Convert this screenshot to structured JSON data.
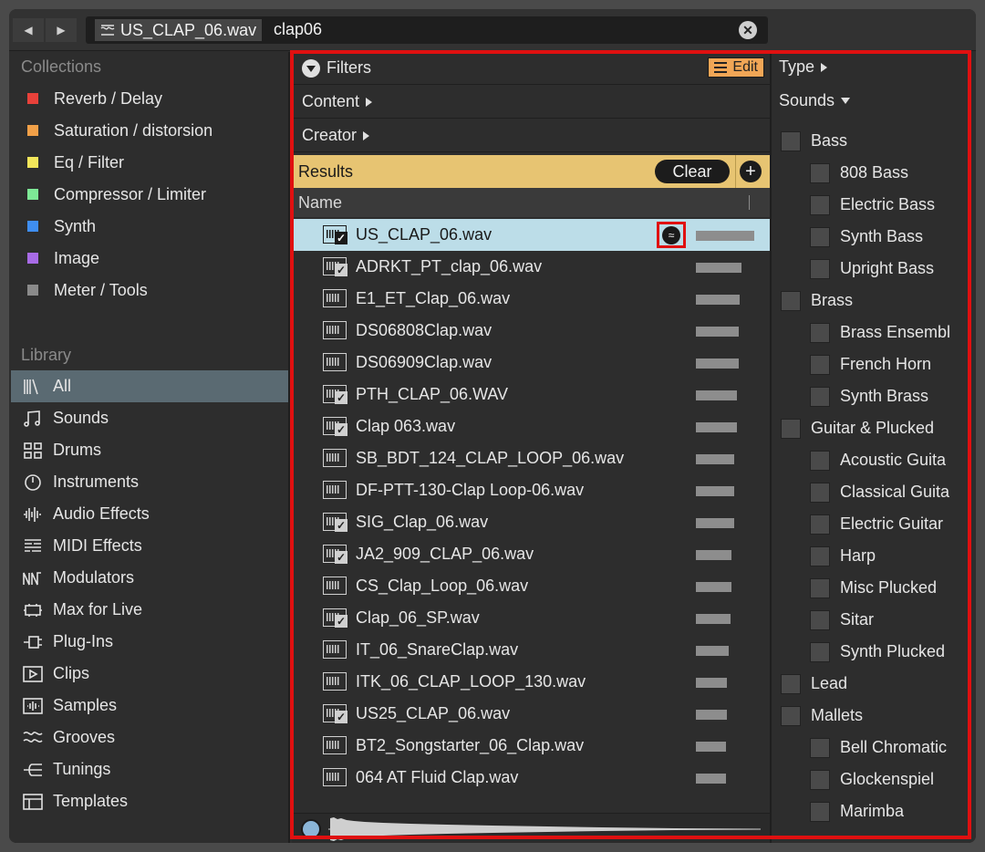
{
  "topbar": {
    "back": "◀",
    "forward": "▶",
    "tag_label": "US_CLAP_06.wav",
    "query": "clap06",
    "clear": "✕"
  },
  "sidebar": {
    "collections_title": "Collections",
    "collections": [
      {
        "label": "Reverb / Delay",
        "color": "#e8413a"
      },
      {
        "label": "Saturation / distorsion",
        "color": "#f1a048"
      },
      {
        "label": "Eq / Filter",
        "color": "#f2e65a"
      },
      {
        "label": "Compressor / Limiter",
        "color": "#7ee896"
      },
      {
        "label": "Synth",
        "color": "#3f8ef0"
      },
      {
        "label": "Image",
        "color": "#a86be6"
      },
      {
        "label": "Meter / Tools",
        "color": "#8a8a8a"
      }
    ],
    "library_title": "Library",
    "library": [
      {
        "label": "All",
        "icon": "all-icon"
      },
      {
        "label": "Sounds",
        "icon": "note-icon"
      },
      {
        "label": "Drums",
        "icon": "drums-grid-icon"
      },
      {
        "label": "Instruments",
        "icon": "instrument-dial-icon"
      },
      {
        "label": "Audio Effects",
        "icon": "audio-effects-icon"
      },
      {
        "label": "MIDI Effects",
        "icon": "midi-effects-icon"
      },
      {
        "label": "Modulators",
        "icon": "modulators-icon"
      },
      {
        "label": "Max for Live",
        "icon": "max-for-live-icon"
      },
      {
        "label": "Plug-Ins",
        "icon": "plug-icon"
      },
      {
        "label": "Clips",
        "icon": "clip-play-icon"
      },
      {
        "label": "Samples",
        "icon": "sample-wave-icon"
      },
      {
        "label": "Grooves",
        "icon": "groove-icon"
      },
      {
        "label": "Tunings",
        "icon": "tuning-icon"
      },
      {
        "label": "Templates",
        "icon": "template-icon"
      }
    ]
  },
  "center": {
    "filters_label": "Filters",
    "edit_label": "Edit",
    "content_label": "Content",
    "creator_label": "Creator",
    "results_label": "Results",
    "clear_label": "Clear",
    "add_label": "+",
    "name_header": "Name",
    "files": [
      {
        "name": "US_CLAP_06.wav",
        "checked": true
      },
      {
        "name": "ADRKT_PT_clap_06.wav",
        "checked": true
      },
      {
        "name": "E1_ET_Clap_06.wav",
        "checked": false
      },
      {
        "name": "DS06808Clap.wav",
        "checked": false
      },
      {
        "name": "DS06909Clap.wav",
        "checked": false
      },
      {
        "name": "PTH_CLAP_06.WAV",
        "checked": true
      },
      {
        "name": "Clap 063.wav",
        "checked": true
      },
      {
        "name": "SB_BDT_124_CLAP_LOOP_06.wav",
        "checked": false
      },
      {
        "name": "DF-PTT-130-Clap Loop-06.wav",
        "checked": false
      },
      {
        "name": "SIG_Clap_06.wav",
        "checked": true
      },
      {
        "name": "JA2_909_CLAP_06.wav",
        "checked": true
      },
      {
        "name": "CS_Clap_Loop_06.wav",
        "checked": false
      },
      {
        "name": "Clap_06_SP.wav",
        "checked": true
      },
      {
        "name": "IT_06_SnareClap.wav",
        "checked": false
      },
      {
        "name": "ITK_06_CLAP_LOOP_130.wav",
        "checked": false
      },
      {
        "name": "US25_CLAP_06.wav",
        "checked": true
      },
      {
        "name": "BT2_Songstarter_06_Clap.wav",
        "checked": false
      },
      {
        "name": "064 AT Fluid Clap.wav",
        "checked": false
      }
    ]
  },
  "right": {
    "type_label": "Type",
    "sounds_label": "Sounds",
    "items": [
      {
        "label": "Bass",
        "level": 0
      },
      {
        "label": "808 Bass",
        "level": 1
      },
      {
        "label": "Electric Bass",
        "level": 1
      },
      {
        "label": "Synth Bass",
        "level": 1
      },
      {
        "label": "Upright Bass",
        "level": 1
      },
      {
        "label": "Brass",
        "level": 0
      },
      {
        "label": "Brass Ensembl",
        "level": 1
      },
      {
        "label": "French Horn",
        "level": 1
      },
      {
        "label": "Synth Brass",
        "level": 1
      },
      {
        "label": "Guitar & Plucked",
        "level": 0
      },
      {
        "label": "Acoustic Guita",
        "level": 1
      },
      {
        "label": "Classical Guita",
        "level": 1
      },
      {
        "label": "Electric Guitar",
        "level": 1
      },
      {
        "label": "Harp",
        "level": 1
      },
      {
        "label": "Misc Plucked",
        "level": 1
      },
      {
        "label": "Sitar",
        "level": 1
      },
      {
        "label": "Synth Plucked",
        "level": 1
      },
      {
        "label": "Lead",
        "level": 0
      },
      {
        "label": "Mallets",
        "level": 0
      },
      {
        "label": "Bell Chromatic",
        "level": 1
      },
      {
        "label": "Glockenspiel",
        "level": 1
      },
      {
        "label": "Marimba",
        "level": 1
      }
    ]
  },
  "colors": {
    "accent_orange": "#f1a656",
    "results_bg": "#e7c472",
    "selection": "#bcdde8",
    "highlight_red": "#e01010"
  }
}
